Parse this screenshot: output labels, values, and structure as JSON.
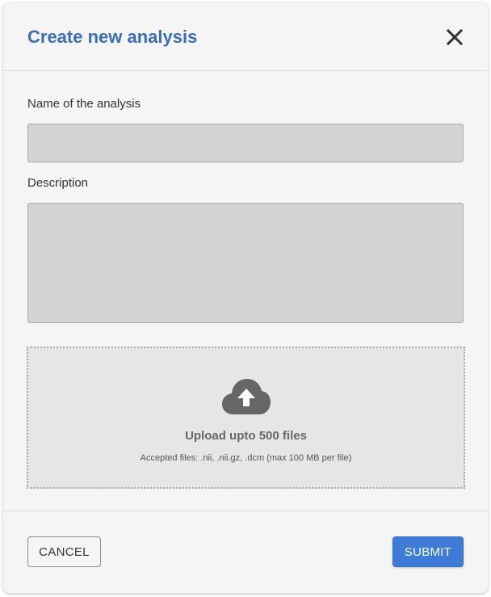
{
  "dialog": {
    "title": "Create new analysis",
    "close_icon": "close-icon"
  },
  "form": {
    "name_label": "Name of the analysis",
    "name_value": "",
    "name_placeholder": "",
    "description_label": "Description",
    "description_value": "",
    "description_placeholder": ""
  },
  "upload": {
    "icon": "cloud-upload-icon",
    "title": "Upload upto 500 files",
    "hint": "Accepted files: .nii, .nii.gz, .dcm (max 100 MB per file)"
  },
  "actions": {
    "cancel_label": "CANCEL",
    "submit_label": "SUBMIT"
  },
  "colors": {
    "title": "#3a6fb7",
    "submit_background": "#3d7bd6",
    "input_background": "#d3d3d3",
    "dropzone_background": "#e6e6e6"
  }
}
